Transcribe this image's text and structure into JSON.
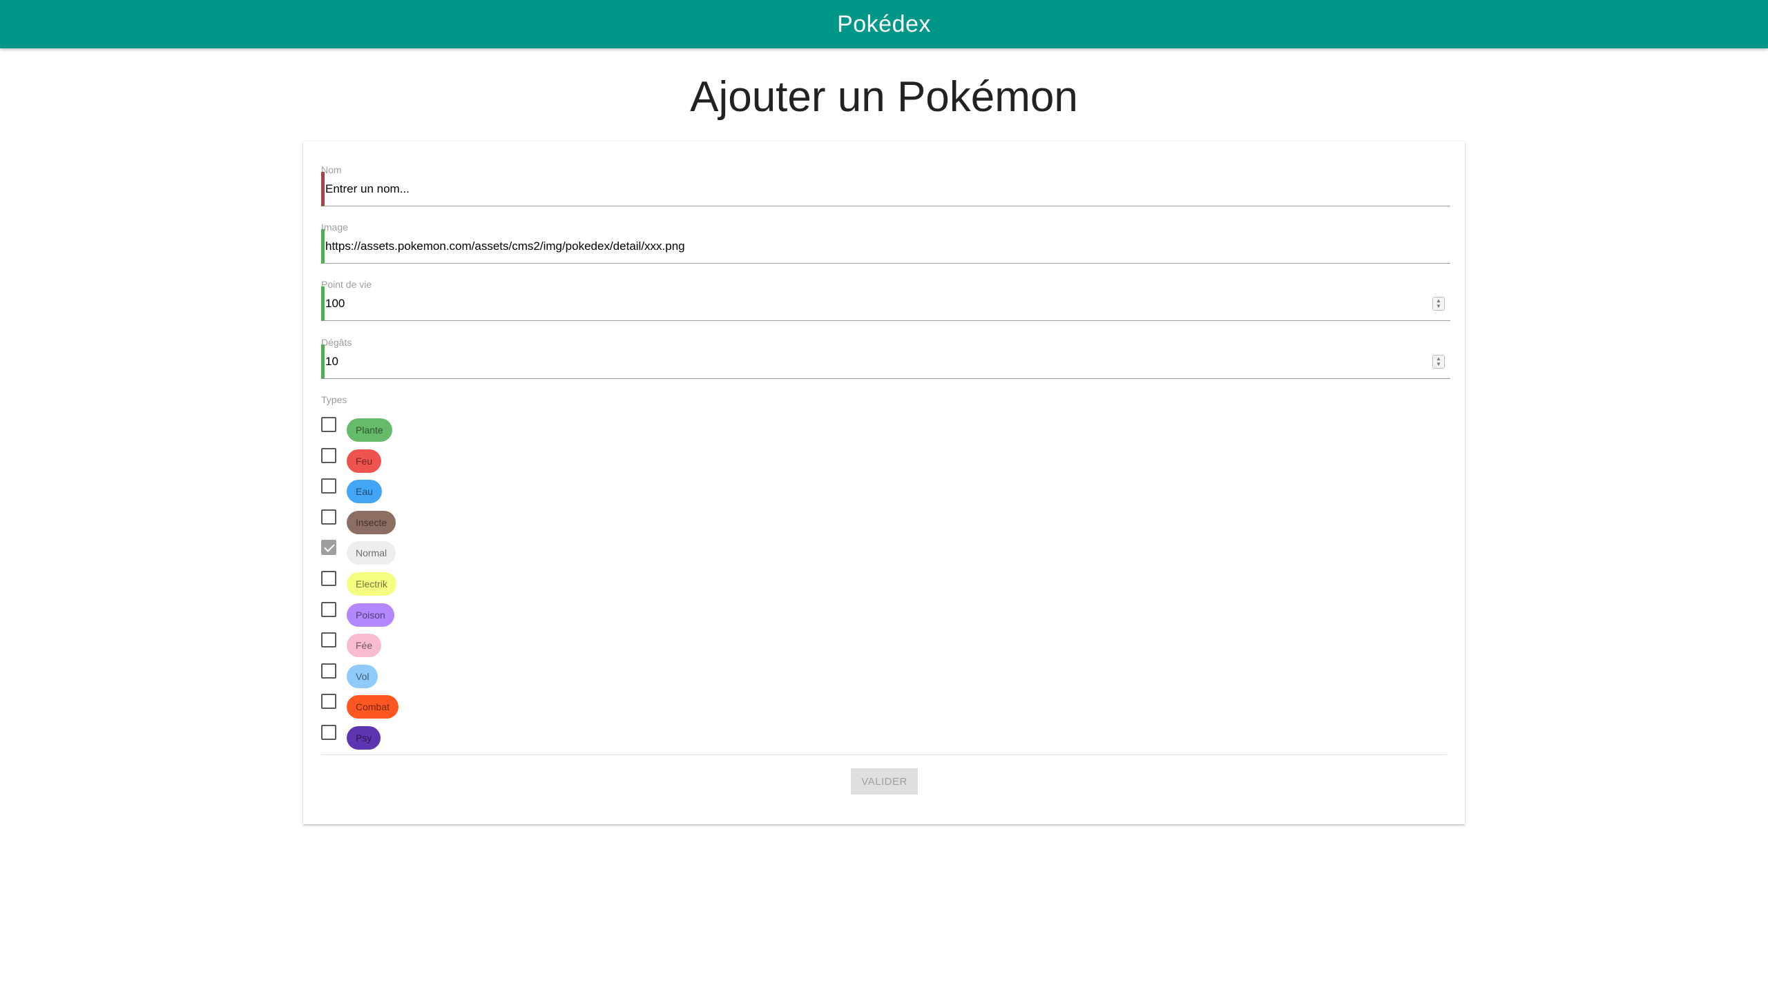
{
  "navbar": {
    "brand": "Pokédex",
    "color": "#009688"
  },
  "page": {
    "title": "Ajouter un Pokémon"
  },
  "form": {
    "name": {
      "label": "Nom",
      "value": "Entrer un nom...",
      "state_color": "#a94442"
    },
    "picture": {
      "label": "Image",
      "value": "https://assets.pokemon.com/assets/cms2/img/pokedex/detail/xxx.png",
      "state_color": "#4caf50"
    },
    "hp": {
      "label": "Point de vie",
      "value": "100",
      "state_color": "#4caf50"
    },
    "cp": {
      "label": "Dégâts",
      "value": "10",
      "state_color": "#4caf50"
    },
    "types": {
      "label": "Types",
      "items": [
        {
          "label": "Plante",
          "color": "#66bb6a",
          "checked": false
        },
        {
          "label": "Feu",
          "color": "#ef5350",
          "checked": false
        },
        {
          "label": "Eau",
          "color": "#42a5f5",
          "checked": false
        },
        {
          "label": "Insecte",
          "color": "#8d6e63",
          "checked": false
        },
        {
          "label": "Normal",
          "color": "#eeeeee",
          "checked": true
        },
        {
          "label": "Electrik",
          "color": "#f4ff81",
          "checked": false
        },
        {
          "label": "Poison",
          "color": "#b388ff",
          "checked": false
        },
        {
          "label": "Fée",
          "color": "#f8bbd0",
          "checked": false
        },
        {
          "label": "Vol",
          "color": "#90caf9",
          "checked": false
        },
        {
          "label": "Combat",
          "color": "#ff5722",
          "checked": false
        },
        {
          "label": "Psy",
          "color": "#5e35b1",
          "checked": false
        }
      ]
    },
    "submit": {
      "label": "VALIDER"
    }
  },
  "icons": {
    "spinner": "number-spinner-icon",
    "check": "checkmark-icon"
  }
}
